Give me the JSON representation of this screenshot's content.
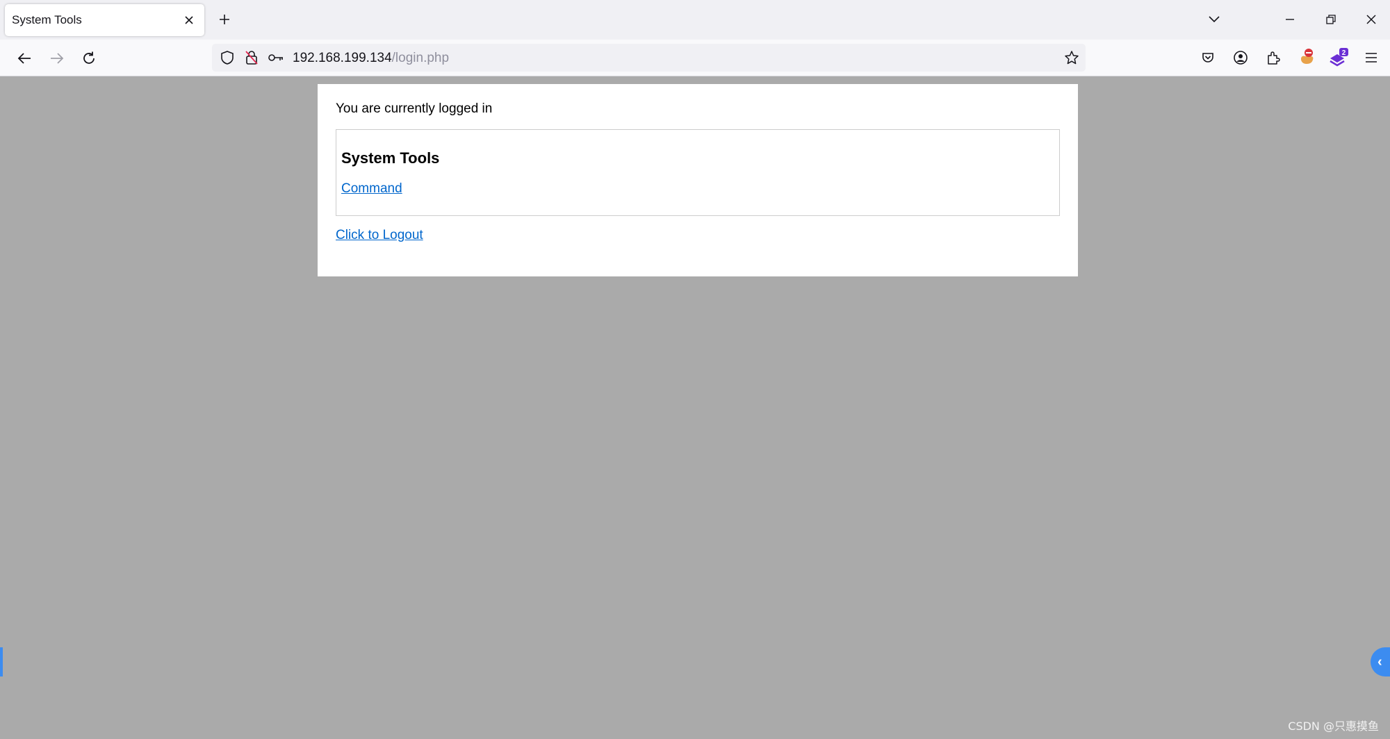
{
  "browser": {
    "tab": {
      "title": "System Tools"
    },
    "url": {
      "host": "192.168.199.134",
      "path": "/login.php"
    },
    "extension_badge": "2"
  },
  "page": {
    "status_text": "You are currently logged in",
    "tools": {
      "heading": "System Tools",
      "command_link": "Command"
    },
    "logout_link": "Click to Logout"
  },
  "overlay": {
    "watermark": "CSDN @只惠摸鱼"
  },
  "colors": {
    "link": "#0066cc",
    "page_background": "#aaaaaa",
    "accent_blue": "#3c8cf0"
  }
}
